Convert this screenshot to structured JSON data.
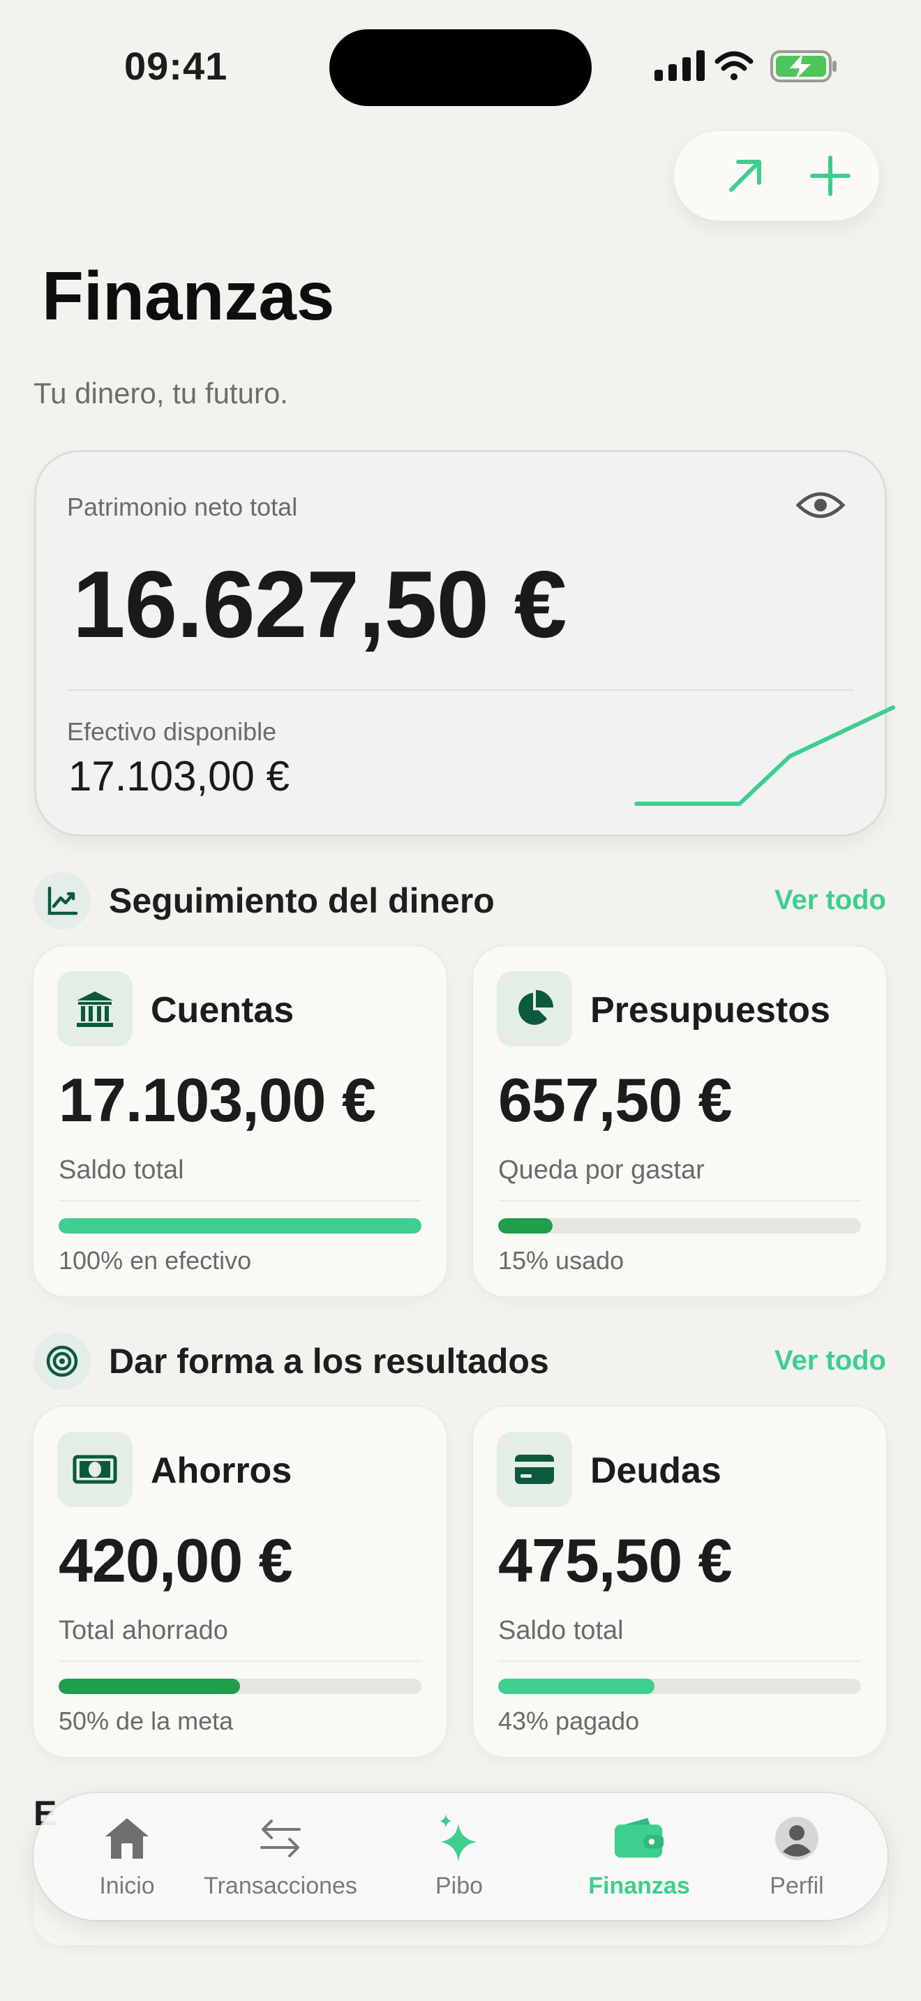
{
  "status_bar": {
    "time": "09:41"
  },
  "header": {
    "title": "Finanzas",
    "subtitle": "Tu dinero, tu futuro."
  },
  "net_worth": {
    "label": "Patrimonio neto total",
    "value": "16.627,50 €",
    "cash_label": "Efectivo disponible",
    "cash_value": "17.103,00 €"
  },
  "sections": [
    {
      "title": "Seguimiento del dinero",
      "see_all": "Ver todo",
      "icon": "chart-line-icon",
      "cards": [
        {
          "title": "Cuentas",
          "icon": "bank-icon",
          "value": "17.103,00 €",
          "subtitle": "Saldo total",
          "progress": 1.0,
          "bar_color": "#3ccf8e",
          "caption": "100% en efectivo"
        },
        {
          "title": "Presupuestos",
          "icon": "pie-chart-icon",
          "value": "657,50 €",
          "subtitle": "Queda por gastar",
          "progress": 0.15,
          "bar_color": "#1f9e4c",
          "caption": "15% usado"
        }
      ]
    },
    {
      "title": "Dar forma a los resultados",
      "see_all": "Ver todo",
      "icon": "target-icon",
      "cards": [
        {
          "title": "Ahorros",
          "icon": "banknote-icon",
          "value": "420,00 €",
          "subtitle": "Total ahorrado",
          "progress": 0.5,
          "bar_color": "#1f9e4c",
          "caption": "50% de la meta"
        },
        {
          "title": "Deudas",
          "icon": "credit-card-icon",
          "value": "475,50 €",
          "subtitle": "Saldo total",
          "progress": 0.43,
          "bar_color": "#3ccf8e",
          "caption": "43% pagado"
        }
      ]
    }
  ],
  "peek_section": {
    "title": "E"
  },
  "nav": {
    "items": [
      {
        "label": "Inicio",
        "icon": "home-icon"
      },
      {
        "label": "Transacciones",
        "icon": "transfer-arrows-icon"
      },
      {
        "label": "Pibo",
        "icon": "sparkle-icon"
      },
      {
        "label": "Finanzas",
        "icon": "wallet-icon",
        "active": true
      },
      {
        "label": "Perfil",
        "icon": "profile-avatar-icon"
      }
    ]
  },
  "colors": {
    "accent": "#3ccf8e",
    "accent_dark": "#1f9e4c",
    "icon_dark": "#0b5a3e",
    "background": "#f4f2ee"
  }
}
